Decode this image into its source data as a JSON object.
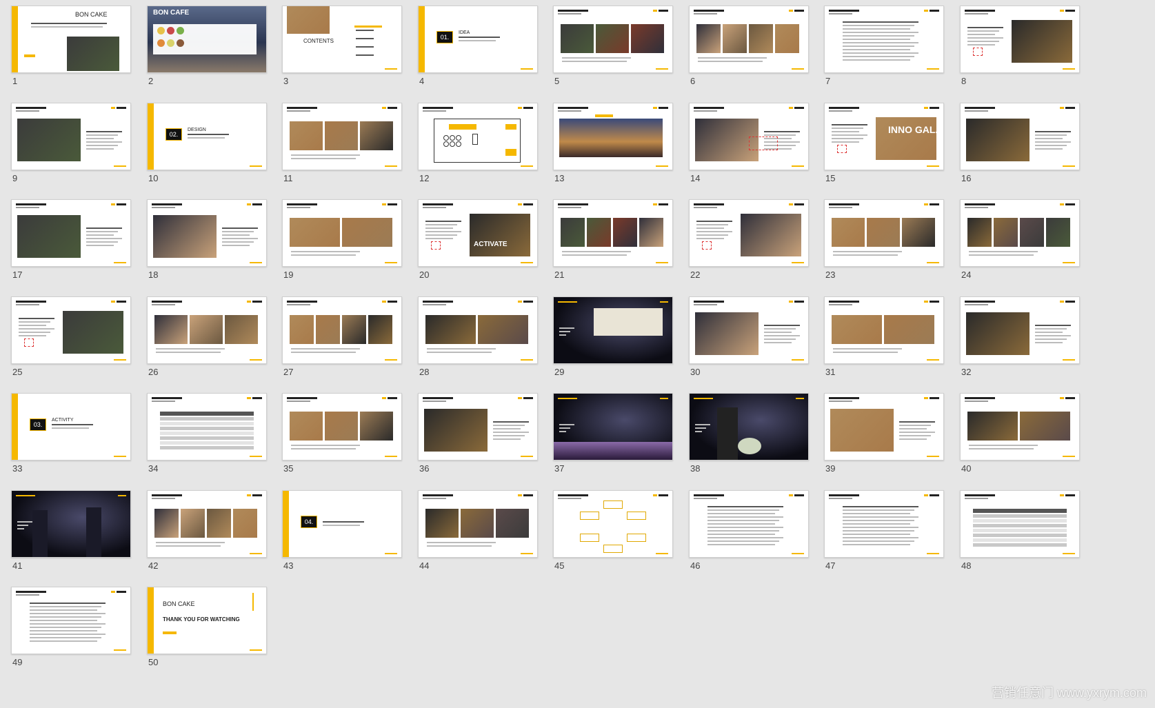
{
  "slides": [
    {
      "number": "1",
      "kind": "title",
      "brand": "BON CAKE"
    },
    {
      "number": "2",
      "kind": "cover-photo",
      "brand": "BON CAFE"
    },
    {
      "number": "3",
      "kind": "contents",
      "label": "CONTENTS"
    },
    {
      "number": "4",
      "kind": "section",
      "section_no": "01.",
      "section_title": "IDEA"
    },
    {
      "number": "5",
      "kind": "photos"
    },
    {
      "number": "6",
      "kind": "photos"
    },
    {
      "number": "7",
      "kind": "text"
    },
    {
      "number": "8",
      "kind": "text-photo"
    },
    {
      "number": "9",
      "kind": "photo-text"
    },
    {
      "number": "10",
      "kind": "section",
      "section_no": "02.",
      "section_title": "DESIGN"
    },
    {
      "number": "11",
      "kind": "photos"
    },
    {
      "number": "12",
      "kind": "floorplan"
    },
    {
      "number": "13",
      "kind": "photo-wide"
    },
    {
      "number": "14",
      "kind": "photo-text"
    },
    {
      "number": "15",
      "kind": "text-photo",
      "caption": "INNO GALA"
    },
    {
      "number": "16",
      "kind": "photo-text"
    },
    {
      "number": "17",
      "kind": "photo-text"
    },
    {
      "number": "18",
      "kind": "photo-text"
    },
    {
      "number": "19",
      "kind": "photos"
    },
    {
      "number": "20",
      "kind": "text-photo",
      "caption": "ACTIVATE"
    },
    {
      "number": "21",
      "kind": "photos"
    },
    {
      "number": "22",
      "kind": "text-photo"
    },
    {
      "number": "23",
      "kind": "photos"
    },
    {
      "number": "24",
      "kind": "photos"
    },
    {
      "number": "25",
      "kind": "text-photo"
    },
    {
      "number": "26",
      "kind": "photos"
    },
    {
      "number": "27",
      "kind": "photos"
    },
    {
      "number": "28",
      "kind": "photos"
    },
    {
      "number": "29",
      "kind": "stage-dark"
    },
    {
      "number": "30",
      "kind": "photo-text"
    },
    {
      "number": "31",
      "kind": "photos"
    },
    {
      "number": "32",
      "kind": "photo-text"
    },
    {
      "number": "33",
      "kind": "section",
      "section_no": "03.",
      "section_title": "ACTIVITY"
    },
    {
      "number": "34",
      "kind": "table"
    },
    {
      "number": "35",
      "kind": "photos"
    },
    {
      "number": "36",
      "kind": "photo-text"
    },
    {
      "number": "37",
      "kind": "stage-dark"
    },
    {
      "number": "38",
      "kind": "stage-dark"
    },
    {
      "number": "39",
      "kind": "photo-text"
    },
    {
      "number": "40",
      "kind": "photos"
    },
    {
      "number": "41",
      "kind": "stage-dark"
    },
    {
      "number": "42",
      "kind": "photos"
    },
    {
      "number": "43",
      "kind": "section",
      "section_no": "04.",
      "section_title": ""
    },
    {
      "number": "44",
      "kind": "photos"
    },
    {
      "number": "45",
      "kind": "flow"
    },
    {
      "number": "46",
      "kind": "text"
    },
    {
      "number": "47",
      "kind": "text"
    },
    {
      "number": "48",
      "kind": "table"
    },
    {
      "number": "49",
      "kind": "text"
    },
    {
      "number": "50",
      "kind": "closing",
      "brand": "BON CAKE",
      "closing_text": "THANK YOU FOR WATCHING"
    }
  ],
  "watermark": "营销任意门 www.yxrym.com",
  "colors": {
    "background": "#e6e6e6",
    "accent": "#f5b800",
    "slide": "#ffffff"
  }
}
